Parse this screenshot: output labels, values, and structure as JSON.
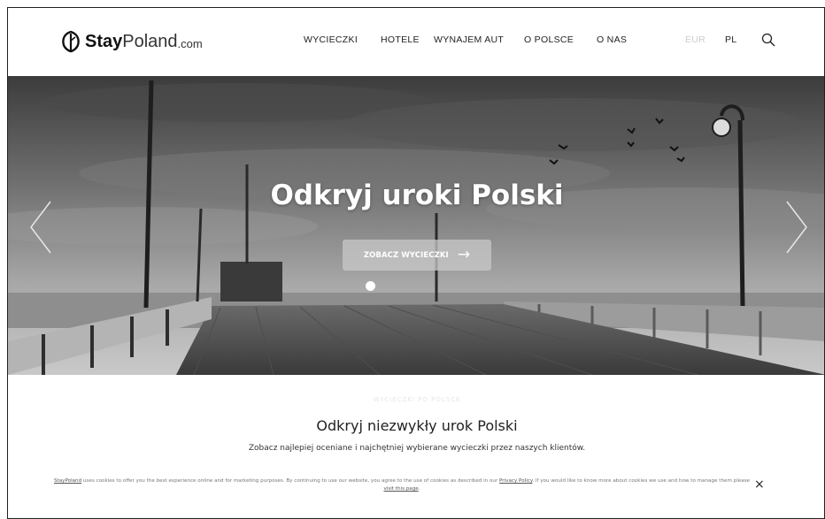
{
  "logo": {
    "stay": "Stay",
    "poland": "Poland",
    "com": ".com"
  },
  "nav": {
    "items": [
      {
        "label": "WYCIECZKI"
      },
      {
        "label": "HOTELE"
      },
      {
        "label": "WYNAJEM AUT"
      },
      {
        "label": "O POLSCE"
      },
      {
        "label": "O NAS"
      }
    ],
    "currency": "EUR",
    "language": "PL"
  },
  "hero": {
    "title": "Odkryj uroki Polski",
    "button_label": "ZOBACZ WYCIECZKI",
    "button_arrow": "→",
    "slide_index": 1,
    "slide_count": 1
  },
  "section": {
    "eyebrow": "WYCIECZKI PO POLSCE",
    "title": "Odkryj niezwykły urok Polski",
    "subtitle": "Zobacz najlepiej oceniane i najchętniej wybierane wycieczki przez naszych klientów."
  },
  "cookie": {
    "brand_link": "StayPoland",
    "text_1": " uses cookies to offer you the best experience online and for marketing purposes. By continuing to use our website, you agree to the use of cookies as described in our ",
    "privacy_link": "Privacy Policy",
    "text_2": ". If you would like to know more about cookies we use and how to manage them please ",
    "visit_link": "visit this page",
    "text_3": ".",
    "close_label": "×"
  },
  "icons": {
    "logo": "leaf-logo-icon",
    "search": "search-icon",
    "prev": "chevron-left-icon",
    "next": "chevron-right-icon",
    "close": "close-icon"
  },
  "colors": {
    "text": "#222222",
    "button_bg": "#c8c8c8",
    "currency_muted": "#cccccc"
  }
}
